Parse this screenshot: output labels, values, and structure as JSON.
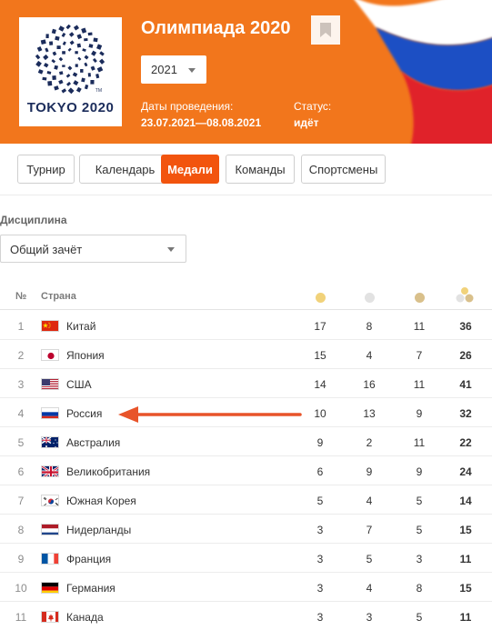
{
  "event": {
    "title": "Олимпиада 2020",
    "logo_text": "TOKYO 2020",
    "logo_tm": "TM",
    "year": "2021",
    "dates_label": "Даты проведения:",
    "dates_value": "23.07.2021—08.08.2021",
    "status_label": "Статус:",
    "status_value": "идёт"
  },
  "tabs": [
    {
      "label": "Турнир",
      "active": false
    },
    {
      "label": "Календарь",
      "active": false
    },
    {
      "label": "Медали",
      "active": true
    },
    {
      "label": "Команды",
      "active": false
    },
    {
      "label": "Спортсмены",
      "active": false
    }
  ],
  "filter": {
    "label": "Дисциплина",
    "value": "Общий зачёт"
  },
  "table": {
    "headers": {
      "rank": "№",
      "country": "Страна"
    },
    "medal_colors": {
      "gold": "#f1d27a",
      "silver": "#e2e2e2",
      "bronze": "#d9c08b"
    },
    "rows": [
      {
        "rank": "1",
        "flag": "china-flag-icon",
        "country": "Китай",
        "gold": "17",
        "silver": "8",
        "bronze": "11",
        "total": "36"
      },
      {
        "rank": "2",
        "flag": "japan-flag-icon",
        "country": "Япония",
        "gold": "15",
        "silver": "4",
        "bronze": "7",
        "total": "26"
      },
      {
        "rank": "3",
        "flag": "usa-flag-icon",
        "country": "США",
        "gold": "14",
        "silver": "16",
        "bronze": "11",
        "total": "41"
      },
      {
        "rank": "4",
        "flag": "russia-flag-icon",
        "country": "Россия",
        "gold": "10",
        "silver": "13",
        "bronze": "9",
        "total": "32"
      },
      {
        "rank": "5",
        "flag": "australia-flag-icon",
        "country": "Австралия",
        "gold": "9",
        "silver": "2",
        "bronze": "11",
        "total": "22"
      },
      {
        "rank": "6",
        "flag": "uk-flag-icon",
        "country": "Великобритания",
        "gold": "6",
        "silver": "9",
        "bronze": "9",
        "total": "24"
      },
      {
        "rank": "7",
        "flag": "south-korea-flag-icon",
        "country": "Южная Корея",
        "gold": "5",
        "silver": "4",
        "bronze": "5",
        "total": "14"
      },
      {
        "rank": "8",
        "flag": "netherlands-flag-icon",
        "country": "Нидерланды",
        "gold": "3",
        "silver": "7",
        "bronze": "5",
        "total": "15"
      },
      {
        "rank": "9",
        "flag": "france-flag-icon",
        "country": "Франция",
        "gold": "3",
        "silver": "5",
        "bronze": "3",
        "total": "11"
      },
      {
        "rank": "10",
        "flag": "germany-flag-icon",
        "country": "Германия",
        "gold": "3",
        "silver": "4",
        "bronze": "8",
        "total": "15"
      },
      {
        "rank": "11",
        "flag": "canada-flag-icon",
        "country": "Канада",
        "gold": "3",
        "silver": "3",
        "bronze": "5",
        "total": "11"
      }
    ]
  },
  "annotation": {
    "arrow_color": "#e8542a",
    "points_to": "Россия"
  },
  "colors": {
    "header_bg": "#f2761c",
    "tab_active_bg": "#f2540e"
  }
}
